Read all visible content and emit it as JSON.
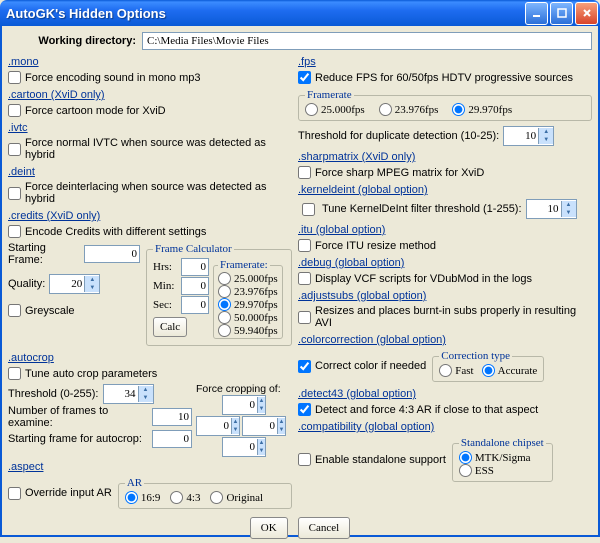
{
  "window": {
    "title": "AutoGK's Hidden Options"
  },
  "wd": {
    "label": "Working directory:",
    "value": "C:\\Media Files\\Movie Files"
  },
  "left": {
    "mono": {
      "h": ".mono",
      "cb": "Force encoding sound in mono mp3",
      "on": false
    },
    "cartoon": {
      "h": ".cartoon (XviD only)",
      "cb": "Force cartoon mode for XviD",
      "on": false
    },
    "ivtc": {
      "h": ".ivtc",
      "cb": "Force normal IVTC when source was detected as hybrid",
      "on": false
    },
    "deint": {
      "h": ".deint",
      "cb": "Force deinterlacing when source was detected as hybrid",
      "on": false
    },
    "credits": {
      "h": ".credits (XviD only)",
      "cb": "Encode Credits with different settings",
      "on": false,
      "sf_label": "Starting Frame:",
      "sf_val": "0",
      "q_label": "Quality:",
      "q_val": "20",
      "grey": "Greyscale",
      "grey_on": false,
      "fc": {
        "legend": "Frame Calculator",
        "hrs": "Hrs:",
        "min": "Min:",
        "sec": "Sec:",
        "hrs_v": "0",
        "min_v": "0",
        "sec_v": "0",
        "btn": "Calc",
        "fr_legend": "Framerate:",
        "r1": "25.000fps",
        "r2": "23.976fps",
        "r3": "29.970fps",
        "r4": "50.000fps",
        "r5": "59.940fps",
        "sel": "r3"
      }
    },
    "autocrop": {
      "h": ".autocrop",
      "cb": "Tune auto crop parameters",
      "on": false,
      "th_label": "Threshold (0-255):",
      "th_val": "34",
      "nf_label": "Number of frames to examine:",
      "nf_val": "10",
      "sf_label": "Starting frame for autocrop:",
      "sf_val": "0",
      "fc_label": "Force cropping of:",
      "x1": "0",
      "y1": "0",
      "x2": "0",
      "y2": "0"
    },
    "aspect": {
      "h": ".aspect",
      "cb": "Override input AR",
      "on": false,
      "legend": "AR",
      "r1": "16:9",
      "r2": "4:3",
      "r3": "Original",
      "sel": "r1"
    }
  },
  "right": {
    "fps": {
      "h": ".fps",
      "cb": "Reduce FPS for 60/50fps HDTV progressive sources",
      "on": true,
      "fr_legend": "Framerate",
      "r1": "25.000fps",
      "r2": "23.976fps",
      "r3": "29.970fps",
      "sel": "r3",
      "th_label": "Threshold for duplicate detection (10-25):",
      "th_val": "10"
    },
    "sharp": {
      "h": ".sharpmatrix (XviD only)",
      "cb": "Force sharp MPEG matrix for XviD",
      "on": false
    },
    "kdeint": {
      "h": ".kerneldeint (global option)",
      "cb": "Tune KernelDeInt filter threshold (1-255):",
      "on": false,
      "val": "10"
    },
    "itu": {
      "h": ".itu (global option)",
      "cb": "Force ITU resize method",
      "on": false
    },
    "debug": {
      "h": ".debug (global option)",
      "cb": "Display VCF scripts for VDubMod in the logs",
      "on": false
    },
    "adjustsubs": {
      "h": ".adjustsubs (global option)",
      "cb": "Resizes and places burnt-in subs properly in resulting AVI",
      "on": false
    },
    "cc": {
      "h": ".colorcorrection (global option)",
      "cb": "Correct color if needed",
      "on": true,
      "legend": "Correction type",
      "r1": "Fast",
      "r2": "Accurate",
      "sel": "r2"
    },
    "d43": {
      "h": ".detect43 (global option)",
      "cb": "Detect and force 4:3 AR if close to that aspect",
      "on": true
    },
    "comp": {
      "h": ".compatibility (global option)",
      "cb": "Enable standalone support",
      "on": false,
      "legend": "Standalone chipset",
      "r1": "MTK/Sigma",
      "r2": "ESS",
      "sel": "r1"
    }
  },
  "btns": {
    "ok": "OK",
    "cancel": "Cancel"
  }
}
